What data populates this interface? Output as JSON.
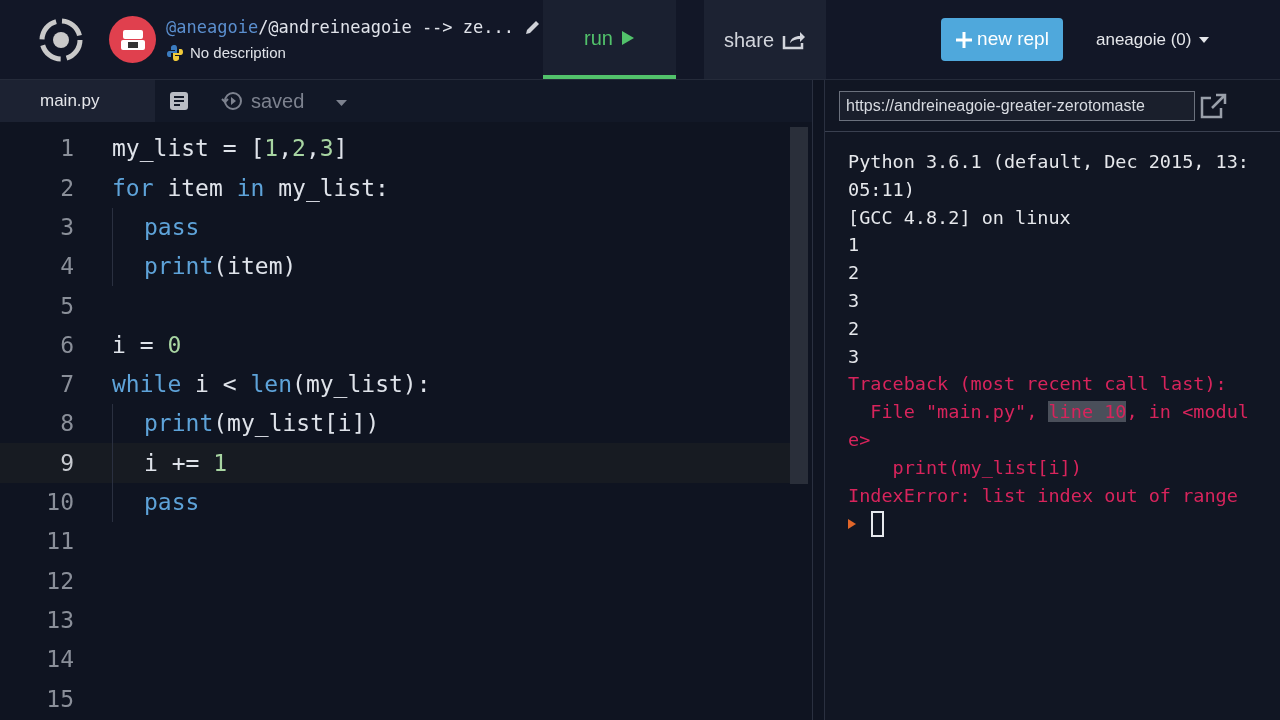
{
  "header": {
    "owner": "@aneagoie",
    "title": "/@andreineagoie --> ze...",
    "description": "No description",
    "tabs": [
      {
        "label": "run",
        "selected": true
      },
      {
        "label": "share",
        "selected": false
      }
    ],
    "new_button": "new repl",
    "user_menu": "aneagoie (0)"
  },
  "editor": {
    "tabs": [
      {
        "label": "main.py",
        "selected": true
      }
    ],
    "status": "saved",
    "lines": [
      {
        "number": "1",
        "active": false,
        "indent": false,
        "tokens": [
          {
            "text": "my_list = [",
            "kind": "plain"
          },
          {
            "text": "1",
            "kind": "number"
          },
          {
            "text": ",",
            "kind": "plain"
          },
          {
            "text": "2",
            "kind": "number"
          },
          {
            "text": ",",
            "kind": "plain"
          },
          {
            "text": "3",
            "kind": "number"
          },
          {
            "text": "]",
            "kind": "plain"
          }
        ]
      },
      {
        "number": "2",
        "active": false,
        "indent": false,
        "tokens": [
          {
            "text": "for",
            "kind": "keyword"
          },
          {
            "text": " item ",
            "kind": "plain"
          },
          {
            "text": "in",
            "kind": "keyword"
          },
          {
            "text": " my_list:",
            "kind": "plain"
          }
        ]
      },
      {
        "number": "3",
        "active": false,
        "indent": true,
        "tokens": [
          {
            "text": "pass",
            "kind": "keyword"
          }
        ]
      },
      {
        "number": "4",
        "active": false,
        "indent": true,
        "tokens": [
          {
            "text": "print",
            "kind": "keyword"
          },
          {
            "text": "(item)",
            "kind": "plain"
          }
        ]
      },
      {
        "number": "5",
        "active": false,
        "indent": false
      },
      {
        "number": "6",
        "active": false,
        "indent": false,
        "tokens": [
          {
            "text": "i = ",
            "kind": "plain"
          },
          {
            "text": "0",
            "kind": "number"
          }
        ]
      },
      {
        "number": "7",
        "active": false,
        "indent": false,
        "tokens": [
          {
            "text": "while",
            "kind": "keyword"
          },
          {
            "text": " i < ",
            "kind": "plain"
          },
          {
            "text": "len",
            "kind": "keyword"
          },
          {
            "text": "(my_list):",
            "kind": "plain"
          }
        ]
      },
      {
        "number": "8",
        "active": false,
        "indent": true,
        "tokens": [
          {
            "text": "print",
            "kind": "keyword"
          },
          {
            "text": "(my_list[i])",
            "kind": "plain"
          }
        ]
      },
      {
        "number": "9",
        "active": true,
        "indent": true,
        "tokens": [
          {
            "text": "i += ",
            "kind": "plain"
          },
          {
            "text": "1",
            "kind": "number"
          }
        ]
      },
      {
        "number": "10",
        "active": false,
        "indent": true,
        "tokens": [
          {
            "text": "pass",
            "kind": "keyword"
          }
        ]
      },
      {
        "number": "11",
        "active": false,
        "indent": false
      },
      {
        "number": "12",
        "active": false,
        "indent": false
      },
      {
        "number": "13",
        "active": false,
        "indent": false
      },
      {
        "number": "14",
        "active": false,
        "indent": false
      },
      {
        "number": "15",
        "active": false,
        "indent": false
      }
    ]
  },
  "console": {
    "url": "https://andreineagoie-greater-zerotomaste",
    "lines": [
      {
        "kind": "output",
        "segments": [
          {
            "text": "Python 3.6.1 (default, Dec 2015, 13:",
            "highlighted": false
          }
        ]
      },
      {
        "kind": "output",
        "segments": [
          {
            "text": "05:11)",
            "highlighted": false
          }
        ]
      },
      {
        "kind": "output",
        "segments": [
          {
            "text": "[GCC 4.8.2] on linux",
            "highlighted": false
          }
        ]
      },
      {
        "kind": "output",
        "segments": [
          {
            "text": "1",
            "highlighted": false
          }
        ]
      },
      {
        "kind": "output",
        "segments": [
          {
            "text": "2",
            "highlighted": false
          }
        ]
      },
      {
        "kind": "output",
        "segments": [
          {
            "text": "3",
            "highlighted": false
          }
        ]
      },
      {
        "kind": "output",
        "segments": [
          {
            "text": "2",
            "highlighted": false
          }
        ]
      },
      {
        "kind": "output",
        "segments": [
          {
            "text": "3",
            "highlighted": false
          }
        ]
      },
      {
        "kind": "error",
        "segments": [
          {
            "text": "Traceback (most recent call last):",
            "highlighted": false
          }
        ]
      },
      {
        "kind": "error",
        "segments": [
          {
            "text": "  File \"main.py\", ",
            "highlighted": false
          },
          {
            "text": "line 10",
            "highlighted": true
          },
          {
            "text": ", in <modul",
            "highlighted": false
          }
        ]
      },
      {
        "kind": "error",
        "segments": [
          {
            "text": "e>",
            "highlighted": false
          }
        ]
      },
      {
        "kind": "error",
        "segments": [
          {
            "text": "    print(my_list[i])",
            "highlighted": false
          }
        ]
      },
      {
        "kind": "error",
        "segments": [
          {
            "text": "IndexError: list index out of range",
            "highlighted": false
          }
        ]
      }
    ]
  }
}
